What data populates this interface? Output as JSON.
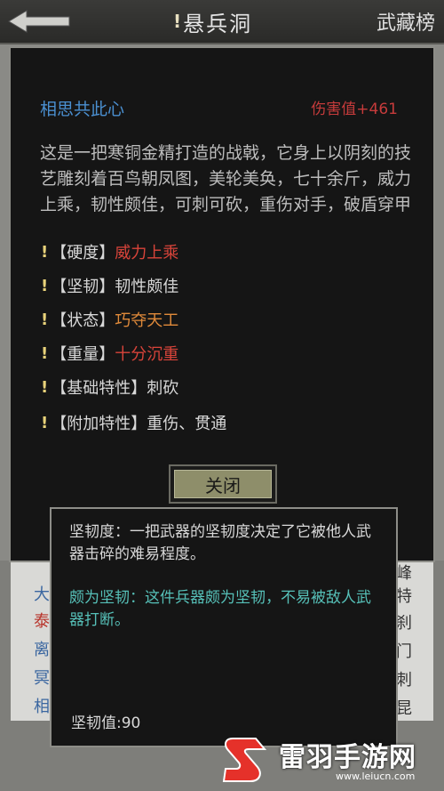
{
  "header": {
    "title_mark": "!",
    "title": "悬兵洞",
    "right_button": "武藏榜"
  },
  "weapon": {
    "name": "相思共此心",
    "damage": "伤害值+461",
    "description": "这是一把寒铜金精打造的战戟，它身上以阴刻的技艺雕刻着百鸟朝凤图，美轮美奂，七十余斤，威力上乘，韧性颇佳，可刺可砍，重伤对手，破盾穿甲",
    "attributes": [
      {
        "label": "【硬度】",
        "value": "威力上乘",
        "color": "#d9443a"
      },
      {
        "label": "【坚韧】",
        "value": "韧性颇佳",
        "color": "#d8d8d8"
      },
      {
        "label": "【状态】",
        "value": "巧夺天工",
        "color": "#e08a3a"
      },
      {
        "label": "【重量】",
        "value": "十分沉重",
        "color": "#d9443a"
      },
      {
        "label": "【基础特性】",
        "value": "刺砍",
        "color": "#d8d8d8"
      },
      {
        "label": "【附加特性】",
        "value": "重伤、贯通",
        "color": "#d8d8d8"
      }
    ],
    "close_label": "关闭"
  },
  "tooltip": {
    "definition": "坚韧度：一把武器的坚韧度决定了它被他人武器击碎的难易程度。",
    "evaluation": "颇为坚韧：这件兵器颇为坚韧，不易被敌人武器打断。",
    "value": "坚韧值:90"
  },
  "background": {
    "left_chars": [
      "大",
      "泰",
      "离",
      "冥",
      "相"
    ],
    "right_chars": [
      "峰",
      "特",
      "刹",
      "门",
      "刺",
      "昆"
    ]
  },
  "watermark": {
    "name": "雷羽手游网",
    "url": "www.leiucn.com"
  },
  "colors": {
    "accent_blue": "#4a8fd0",
    "damage_red": "#c63b3b",
    "tip_teal": "#56c0b8",
    "watermark_red": "#e5312a"
  }
}
